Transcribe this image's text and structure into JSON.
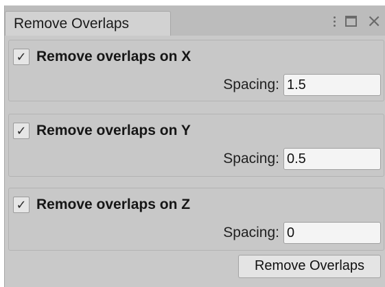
{
  "window": {
    "tab_title": "Remove Overlaps",
    "icons": [
      "kebab-menu-icon",
      "maximize-icon",
      "close-icon"
    ]
  },
  "groups": [
    {
      "label": "Remove overlaps on X",
      "checked": true,
      "spacing_label": "Spacing:",
      "spacing_value": "1.5"
    },
    {
      "label": "Remove overlaps on Y",
      "checked": true,
      "spacing_label": "Spacing:",
      "spacing_value": "0.5"
    },
    {
      "label": "Remove overlaps on Z",
      "checked": true,
      "spacing_label": "Spacing:",
      "spacing_value": "0"
    }
  ],
  "checkmark": "✓",
  "action_button": {
    "label": "Remove Overlaps"
  }
}
